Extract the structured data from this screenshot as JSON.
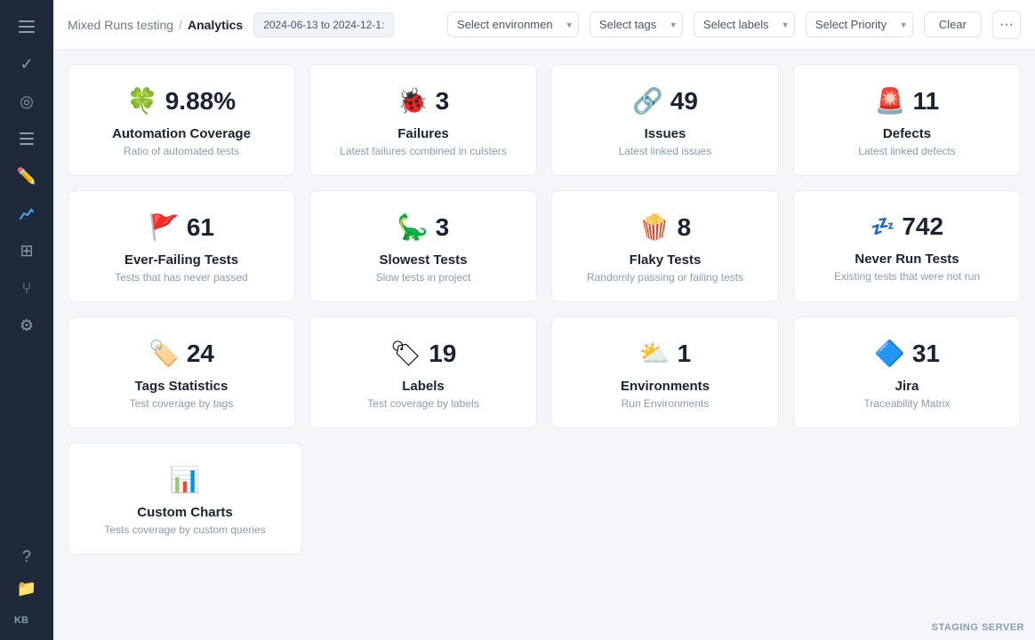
{
  "sidebar": {
    "items": [
      {
        "name": "menu-icon",
        "icon": "☰",
        "active": false
      },
      {
        "name": "check-icon",
        "icon": "✓",
        "active": false
      },
      {
        "name": "activity-icon",
        "icon": "◉",
        "active": false
      },
      {
        "name": "list-icon",
        "icon": "≡",
        "active": false
      },
      {
        "name": "chart-line-icon",
        "icon": "📈",
        "active": false
      },
      {
        "name": "wave-icon",
        "icon": "〜",
        "active": true
      },
      {
        "name": "table-icon",
        "icon": "⊞",
        "active": false
      },
      {
        "name": "tag-icon",
        "icon": "⌂",
        "active": false
      },
      {
        "name": "gear-icon",
        "icon": "⚙",
        "active": false
      }
    ],
    "bottom_items": [
      {
        "name": "help-icon",
        "icon": "?"
      },
      {
        "name": "folder-icon",
        "icon": "📁"
      }
    ],
    "kb_label": "KB"
  },
  "header": {
    "breadcrumb_parent": "Mixed Runs testing",
    "separator": "/",
    "current_page": "Analytics",
    "date_range": "2024-06-13 to 2024-12-1:",
    "filters": [
      {
        "id": "environment",
        "placeholder": "Select environmen",
        "label": "Select environment"
      },
      {
        "id": "tags",
        "placeholder": "Select tags",
        "label": "Select tags"
      },
      {
        "id": "labels",
        "placeholder": "Select labels",
        "label": "Select labels"
      },
      {
        "id": "priority",
        "placeholder": "Select Priority",
        "label": "Select Priority"
      }
    ],
    "clear_label": "Clear",
    "more_label": "···"
  },
  "cards": {
    "row1": [
      {
        "id": "automation-coverage",
        "icon": "🍀",
        "number": "9.88%",
        "title": "Automation Coverage",
        "description": "Ratio of automated tests"
      },
      {
        "id": "failures",
        "icon": "🐞",
        "number": "3",
        "title": "Failures",
        "description": "Latest failures combined in culsters"
      },
      {
        "id": "issues",
        "icon": "🔗",
        "number": "49",
        "title": "Issues",
        "description": "Latest linked issues"
      },
      {
        "id": "defects",
        "icon": "🚨",
        "number": "11",
        "title": "Defects",
        "description": "Latest linked defects"
      }
    ],
    "row2": [
      {
        "id": "ever-failing-tests",
        "icon": "🚩",
        "number": "61",
        "title": "Ever-Failing Tests",
        "description": "Tests that has never passed"
      },
      {
        "id": "slowest-tests",
        "icon": "🦕",
        "number": "3",
        "title": "Slowest Tests",
        "description": "Slow tests in project"
      },
      {
        "id": "flaky-tests",
        "icon": "🍿",
        "number": "8",
        "title": "Flaky Tests",
        "description": "Randomly passing or failing tests"
      },
      {
        "id": "never-run-tests",
        "icon": "💤",
        "number": "742",
        "title": "Never Run Tests",
        "description": "Existing tests that were not run"
      }
    ],
    "row3": [
      {
        "id": "tags-statistics",
        "icon": "🏷️",
        "number": "24",
        "title": "Tags Statistics",
        "description": "Test coverage by tags"
      },
      {
        "id": "labels",
        "icon": "🏷",
        "number": "19",
        "title": "Labels",
        "description": "Test coverage by labels"
      },
      {
        "id": "environments",
        "icon": "⛅",
        "number": "1",
        "title": "Environments",
        "description": "Run Environments"
      },
      {
        "id": "jira",
        "icon": "🔷",
        "number": "31",
        "title": "Jira",
        "description": "Traceability Matrix"
      }
    ],
    "row4": [
      {
        "id": "custom-charts",
        "icon": "📊",
        "title": "Custom Charts",
        "description": "Tests coverage by custom queries"
      }
    ]
  },
  "staging": "STAGING SERVER"
}
